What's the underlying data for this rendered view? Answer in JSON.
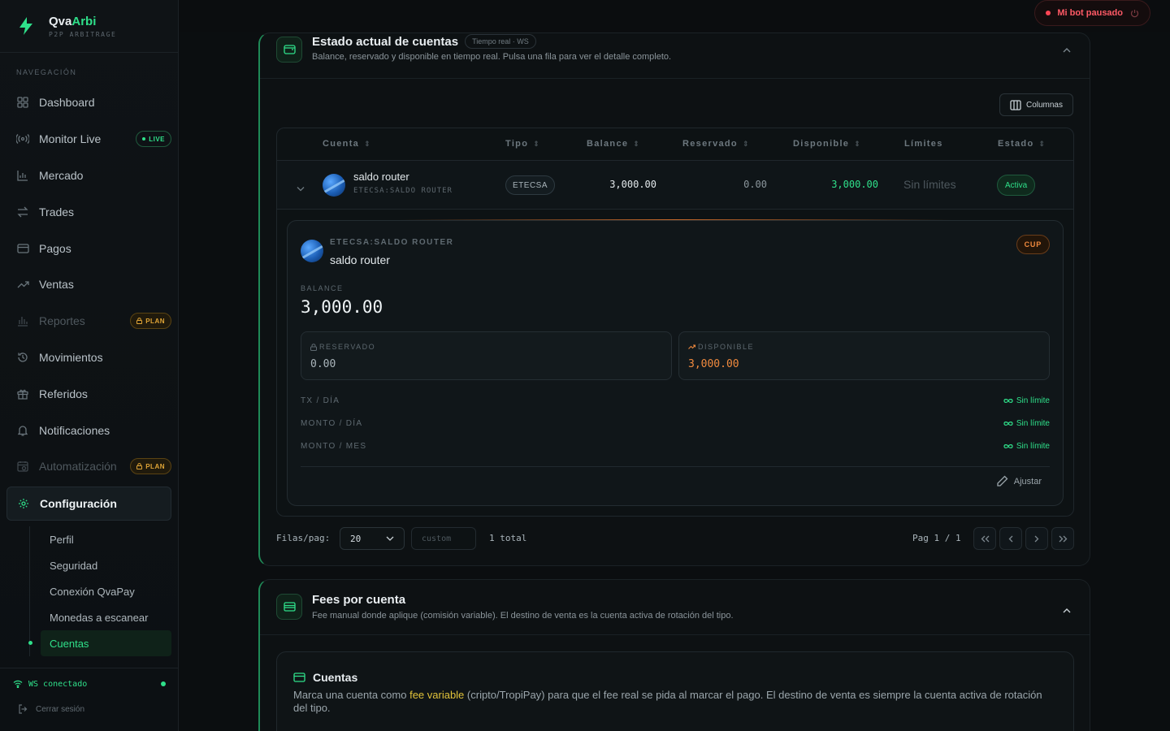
{
  "brand": {
    "name_main": "Qva",
    "name_accent": "Arbi",
    "subtitle": "P2P ARBITRAGE"
  },
  "sidebar": {
    "section_label": "NAVEGACIÓN",
    "items": [
      {
        "label": "Dashboard",
        "icon": "grid-icon"
      },
      {
        "label": "Monitor Live",
        "icon": "broadcast-icon",
        "badge": "LIVE"
      },
      {
        "label": "Mercado",
        "icon": "bar-chart-icon"
      },
      {
        "label": "Trades",
        "icon": "swap-icon"
      },
      {
        "label": "Pagos",
        "icon": "card-icon"
      },
      {
        "label": "Ventas",
        "icon": "trend-up-icon"
      },
      {
        "label": "Reportes",
        "icon": "column-chart-icon",
        "badge": "PLAN"
      },
      {
        "label": "Movimientos",
        "icon": "history-icon"
      },
      {
        "label": "Referidos",
        "icon": "gift-icon"
      },
      {
        "label": "Notificaciones",
        "icon": "bell-icon"
      },
      {
        "label": "Automatización",
        "icon": "calendar-clock-icon",
        "badge": "PLAN"
      },
      {
        "label": "Configuración",
        "icon": "gear-icon"
      }
    ],
    "sub_items": [
      "Perfil",
      "Seguridad",
      "Conexión QvaPay",
      "Monedas a escanear",
      "Cuentas"
    ],
    "ws_status": "WS conectado",
    "logout": "Cerrar sesión"
  },
  "topbar": {
    "bot_status": "Mi bot pausado"
  },
  "accounts_card": {
    "title": "Estado actual de cuentas",
    "realtime_pill": "Tiempo real · WS",
    "subtitle": "Balance, reservado y disponible en tiempo real. Pulsa una fila para ver el detalle completo.",
    "columns_button": "Columnas",
    "headers": [
      "Cuenta",
      "Tipo",
      "Balance",
      "Reservado",
      "Disponible",
      "Límites",
      "Estado"
    ],
    "row": {
      "name": "saldo router",
      "id": "ETECSA:SALDO ROUTER",
      "type": "ETECSA",
      "balance": "3,000.00",
      "reserved": "0.00",
      "available": "3,000.00",
      "limits": "Sin límites",
      "status": "Activa"
    },
    "detail": {
      "id": "ETECSA:SALDO ROUTER",
      "name": "saldo router",
      "currency": "CUP",
      "balance_label": "BALANCE",
      "balance": "3,000.00",
      "reserved_label": "RESERVADO",
      "reserved": "0.00",
      "available_label": "DISPONIBLE",
      "available": "3,000.00",
      "limits": [
        {
          "label": "TX / DÍA",
          "value": "Sin límite"
        },
        {
          "label": "MONTO / DÍA",
          "value": "Sin límite"
        },
        {
          "label": "MONTO / MES",
          "value": "Sin límite"
        }
      ],
      "adjust_button": "Ajustar"
    },
    "pager": {
      "rows_label": "Filas/pag:",
      "rows_value": "20",
      "custom_placeholder": "custom",
      "total": "1 total",
      "page_label": "Pag 1 / 1"
    }
  },
  "fees_card": {
    "title": "Fees por cuenta",
    "subtitle": "Fee manual donde aplique (comisión variable). El destino de venta es la cuenta activa de rotación del tipo.",
    "inner_title": "Cuentas",
    "inner_text_before": "Marca una cuenta como ",
    "inner_text_highlight": "fee variable",
    "inner_text_after": " (cripto/TropiPay) para que el fee real se pida al marcar el pago. El destino de venta es siempre la cuenta activa de rotación del tipo."
  },
  "colors": {
    "accent": "#2fe08a",
    "warning": "#e0a537",
    "danger": "#ff4655",
    "orange": "#f08a3e"
  }
}
